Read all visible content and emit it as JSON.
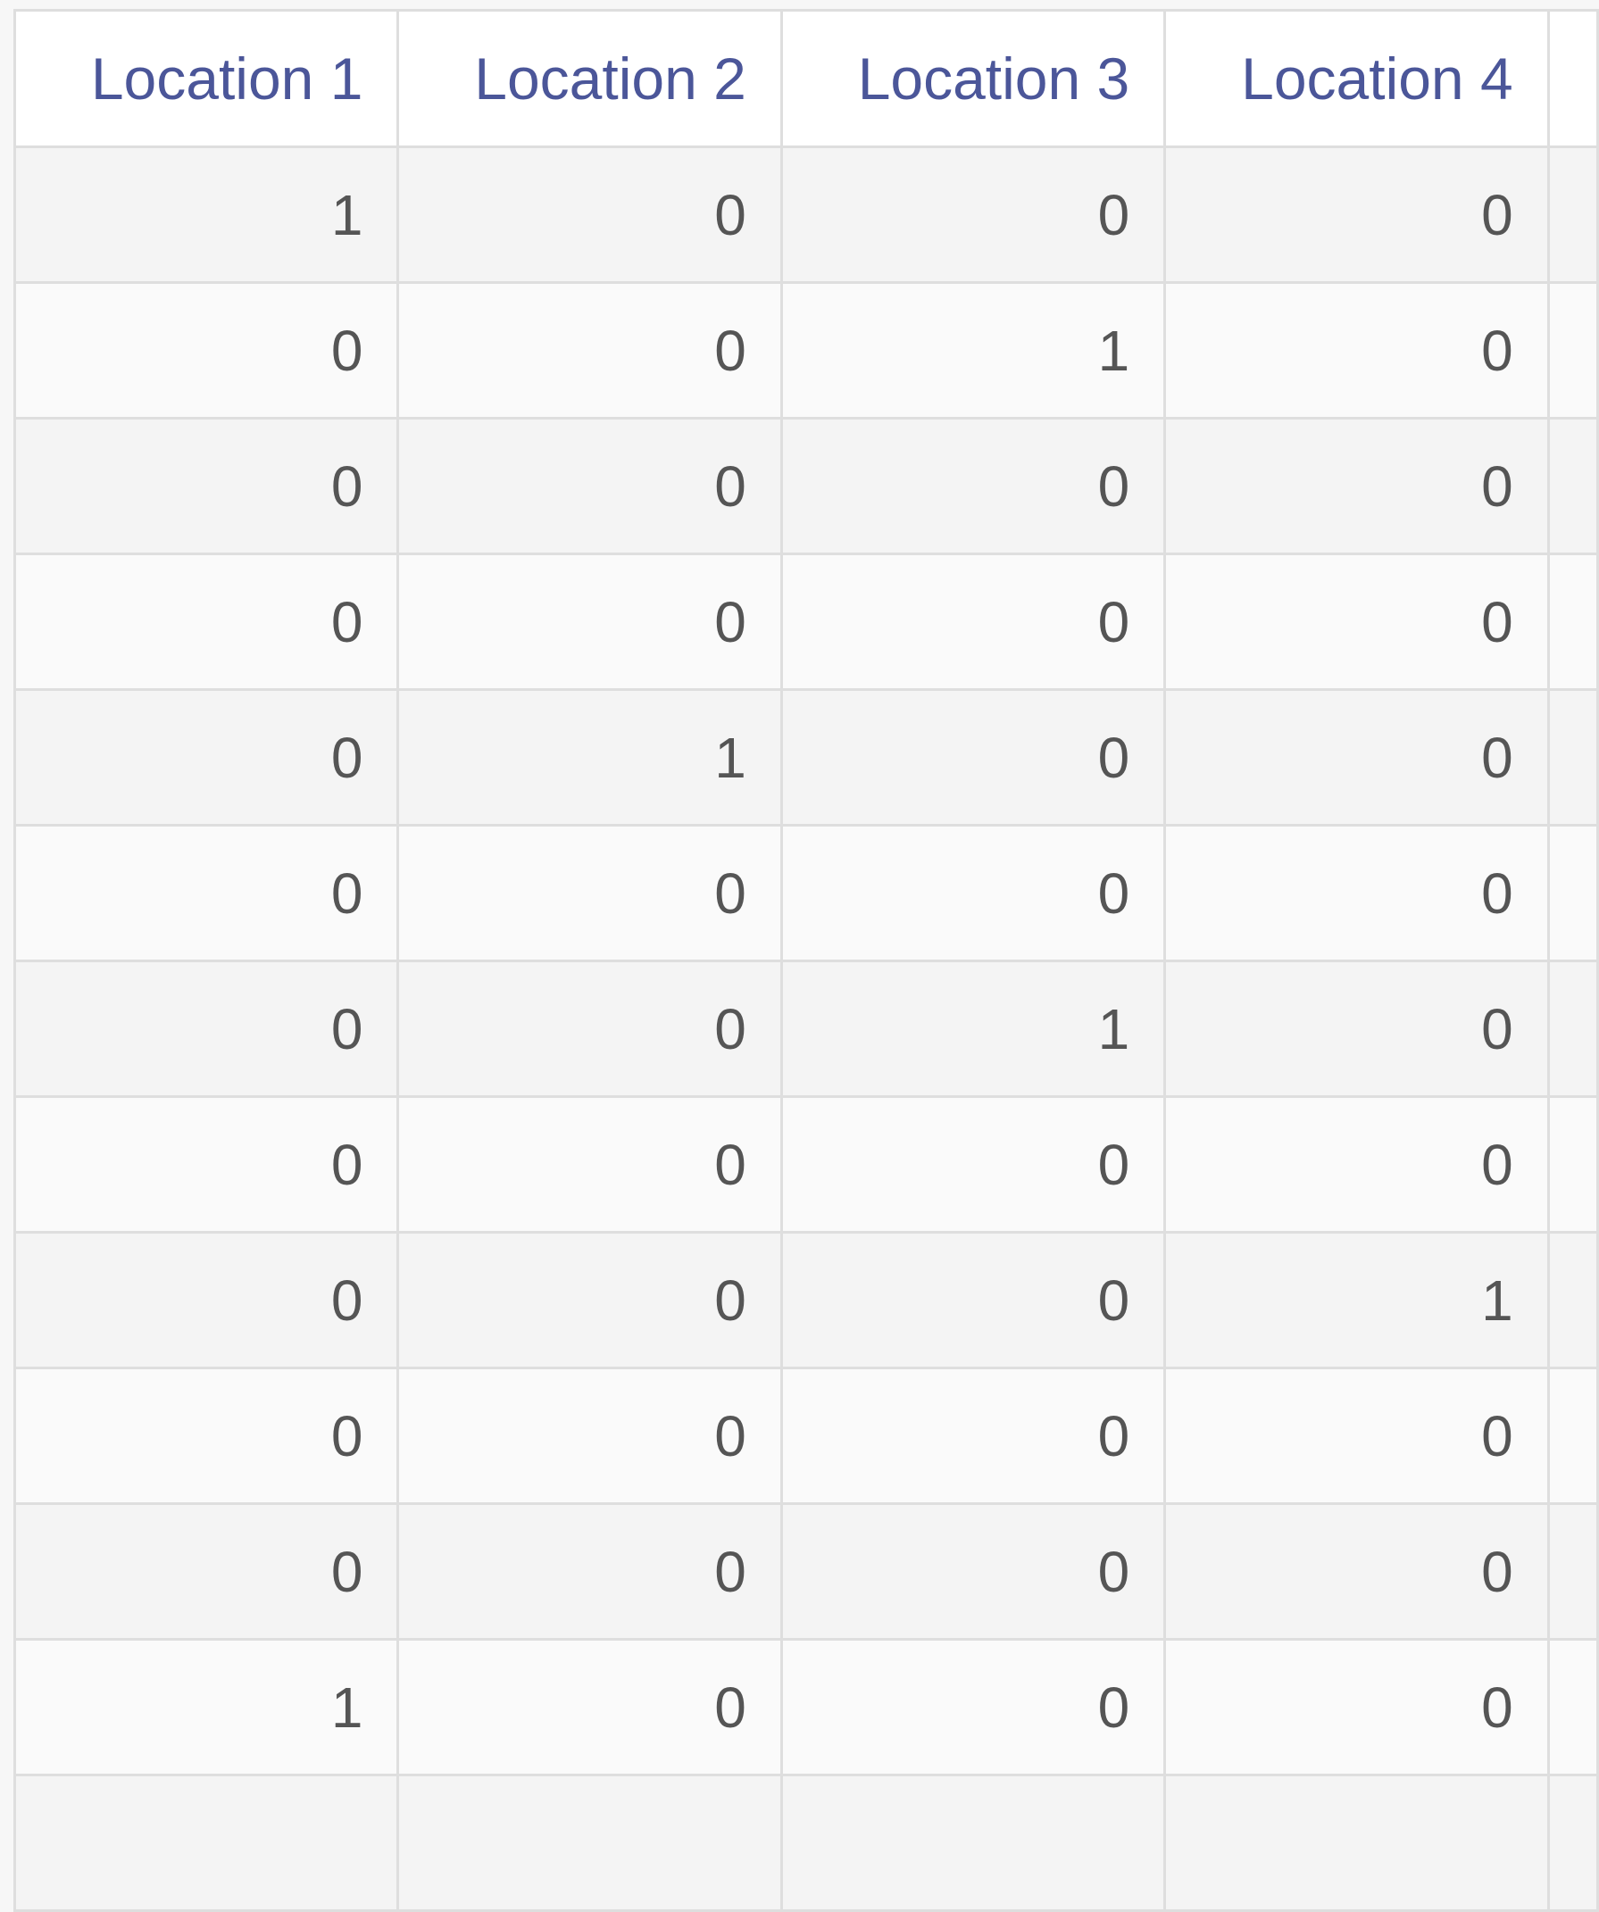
{
  "table": {
    "columns": [
      "Location 1",
      "Location 2",
      "Location 3",
      "Location 4"
    ],
    "rows": [
      [
        "1",
        "0",
        "0",
        "0"
      ],
      [
        "0",
        "0",
        "1",
        "0"
      ],
      [
        "0",
        "0",
        "0",
        "0"
      ],
      [
        "0",
        "0",
        "0",
        "0"
      ],
      [
        "0",
        "1",
        "0",
        "0"
      ],
      [
        "0",
        "0",
        "0",
        "0"
      ],
      [
        "0",
        "0",
        "1",
        "0"
      ],
      [
        "0",
        "0",
        "0",
        "0"
      ],
      [
        "0",
        "0",
        "0",
        "1"
      ],
      [
        "0",
        "0",
        "0",
        "0"
      ],
      [
        "0",
        "0",
        "0",
        "0"
      ],
      [
        "1",
        "0",
        "0",
        "0"
      ],
      [
        "",
        "",
        "",
        ""
      ]
    ]
  },
  "colors": {
    "header_text": "#4b5699",
    "cell_text": "#555555",
    "row_odd": "#f4f4f4",
    "row_even": "#fafafa",
    "grid_line": "#dedede"
  }
}
